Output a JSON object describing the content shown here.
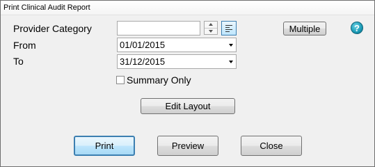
{
  "window": {
    "title": "Print Clinical Audit Report"
  },
  "provider_category": {
    "label": "Provider Category",
    "value": ""
  },
  "multiple_button": {
    "label": "Multiple"
  },
  "help": {
    "glyph": "?"
  },
  "from": {
    "label": "From",
    "value": "01/01/2015"
  },
  "to": {
    "label": "To",
    "value": "31/12/2015"
  },
  "summary_only": {
    "label": "Summary Only",
    "checked": false
  },
  "edit_layout_button": {
    "label": "Edit Layout"
  },
  "footer": {
    "print_label": "Print",
    "preview_label": "Preview",
    "close_label": "Close"
  },
  "colors": {
    "accent_border": "#3c7fb1",
    "help_icon": "#1a9ab5",
    "background": "#f0f0f0"
  }
}
